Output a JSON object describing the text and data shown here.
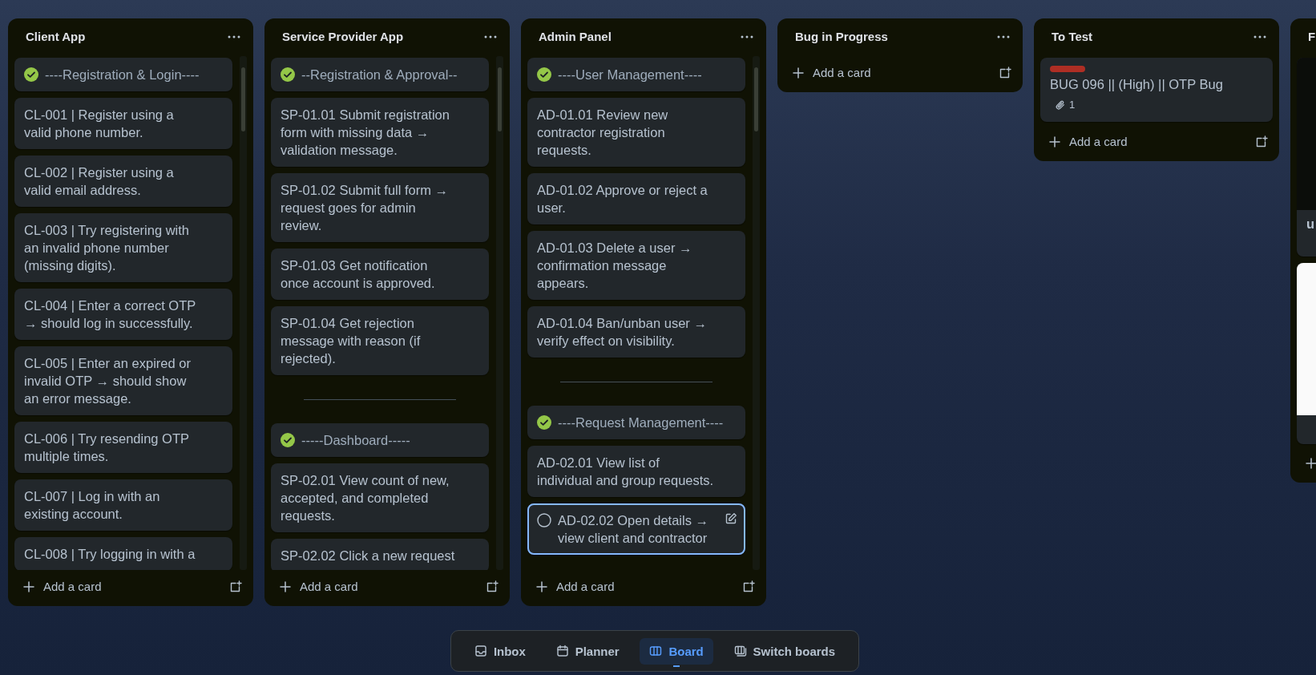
{
  "columns": [
    {
      "title": "Client App",
      "add_label": "Add a card",
      "cards": [
        {
          "kind": "checklist",
          "done": true,
          "text": "----Registration & Login----"
        },
        {
          "kind": "task",
          "text": "CL-001 | Register using a valid phone number."
        },
        {
          "kind": "task",
          "text": "CL-002 | Register using a valid email address."
        },
        {
          "kind": "task",
          "text": "CL-003 | Try registering with an invalid phone number (missing digits)."
        },
        {
          "kind": "task",
          "text": "CL-004 | Enter a correct OTP → should log in successfully."
        },
        {
          "kind": "task",
          "text": "CL-005 | Enter an expired or invalid OTP → should show an error message."
        },
        {
          "kind": "task",
          "text": "CL-006 | Try resending OTP multiple times."
        },
        {
          "kind": "task",
          "text": "CL-007 | Log in with an existing account."
        },
        {
          "kind": "task",
          "text": "CL-008 | Try logging in with a"
        }
      ]
    },
    {
      "title": "Service Provider App",
      "add_label": "Add a card",
      "cards": [
        {
          "kind": "checklist",
          "done": true,
          "text": "--Registration & Approval--"
        },
        {
          "kind": "task",
          "text": "SP-01.01 Submit registration form with missing data → validation message."
        },
        {
          "kind": "task",
          "text": "SP-01.02 Submit full form → request goes for admin review."
        },
        {
          "kind": "task",
          "text": "SP-01.03 Get notification once account is approved."
        },
        {
          "kind": "task",
          "text": "SP-01.04 Get rejection message with reason (if rejected)."
        },
        {
          "kind": "separator"
        },
        {
          "kind": "checklist",
          "done": true,
          "text": "-----Dashboard-----"
        },
        {
          "kind": "task",
          "text": "SP-02.01 View count of new, accepted, and completed requests."
        },
        {
          "kind": "task",
          "text": "SP-02.02 Click a new request"
        }
      ]
    },
    {
      "title": "Admin Panel",
      "add_label": "Add a card",
      "cards": [
        {
          "kind": "checklist",
          "done": true,
          "text": "----User Management----"
        },
        {
          "kind": "task",
          "text": "AD-01.01 Review new contractor registration requests."
        },
        {
          "kind": "task",
          "text": "AD-01.02 Approve or reject a user."
        },
        {
          "kind": "task",
          "text": "AD-01.03 Delete a user → confirmation message appears."
        },
        {
          "kind": "task",
          "text": "AD-01.04 Ban/unban user → verify effect on visibility."
        },
        {
          "kind": "separator"
        },
        {
          "kind": "checklist",
          "done": true,
          "text": "----Request Management----"
        },
        {
          "kind": "task",
          "text": "AD-02.01 View list of individual and group requests."
        },
        {
          "kind": "checklist",
          "done": false,
          "focused": true,
          "text": "AD-02.02 Open details → view client and contractor"
        }
      ]
    },
    {
      "title": "Bug in Progress",
      "add_label": "Add a card"
    },
    {
      "title": "To Test",
      "add_label": "Add a card",
      "cards": [
        {
          "kind": "labeled",
          "labels": [
            {
              "color": "#ae2e24"
            }
          ],
          "text": "BUG 096 || (High) || OTP Bug",
          "attachments": "1"
        }
      ]
    },
    {
      "title": "F",
      "cards": [
        {
          "kind": "cover",
          "color": "#0b0d0a",
          "text": "u"
        },
        {
          "kind": "cover",
          "color": "#fafafa"
        }
      ]
    }
  ],
  "nav": [
    {
      "kind": "inbox",
      "label": "Inbox",
      "selected": false
    },
    {
      "kind": "planner",
      "label": "Planner",
      "selected": false
    },
    {
      "kind": "board",
      "label": "Board",
      "selected": true
    },
    {
      "kind": "switch",
      "label": "Switch boards",
      "selected": false
    }
  ]
}
